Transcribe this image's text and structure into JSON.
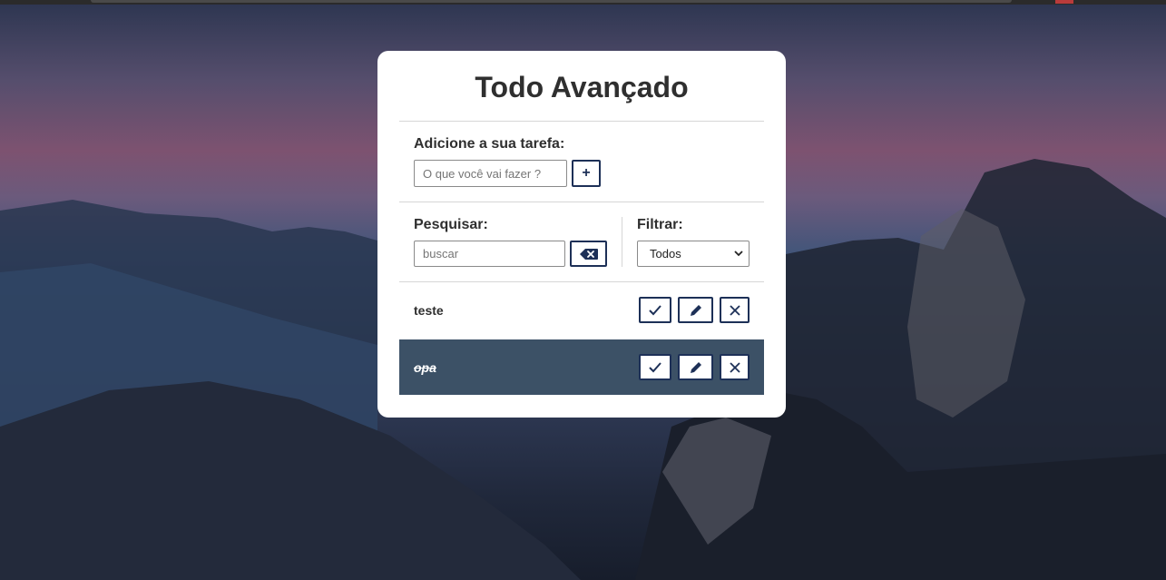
{
  "app": {
    "title": "Todo Avançado"
  },
  "add_section": {
    "label": "Adicione a sua tarefa:",
    "input_placeholder": "O que você vai fazer ?",
    "input_value": "",
    "add_button_icon": "plus-icon",
    "add_button_label": "+"
  },
  "search_section": {
    "label": "Pesquisar:",
    "input_placeholder": "buscar",
    "input_value": "",
    "clear_button_icon": "backspace-icon"
  },
  "filter_section": {
    "label": "Filtrar:",
    "selected": "Todos"
  },
  "todos": [
    {
      "text": "teste",
      "done": false
    },
    {
      "text": "opa",
      "done": true
    }
  ],
  "todo_actions": {
    "done_icon": "check-icon",
    "edit_icon": "pencil-icon",
    "remove_icon": "x-icon"
  },
  "colors": {
    "accent": "#1d3057",
    "done_row_background": "#3c5166",
    "card_background": "#ffffff"
  }
}
